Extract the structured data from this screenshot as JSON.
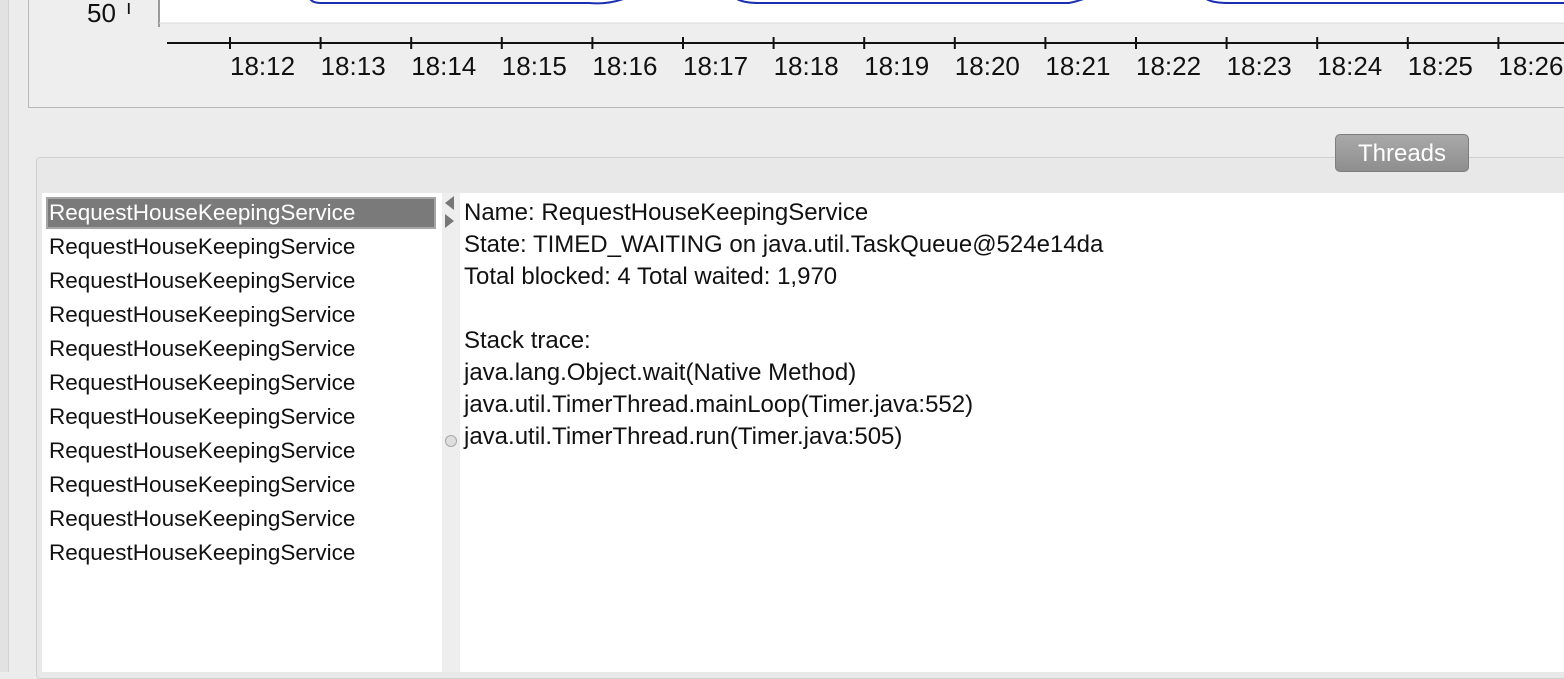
{
  "chart": {
    "y_tick_label": "50",
    "time_labels": [
      "18:12",
      "18:13",
      "18:14",
      "18:15",
      "18:16",
      "18:17",
      "18:18",
      "18:19",
      "18:20",
      "18:21",
      "18:22",
      "18:23",
      "18:24",
      "18:25",
      "18:26"
    ],
    "line_color": "#1a2fb0"
  },
  "tabs": {
    "threads_label": "Threads"
  },
  "thread_list": {
    "items": [
      "RequestHouseKeepingService",
      "RequestHouseKeepingService",
      "RequestHouseKeepingService",
      "RequestHouseKeepingService",
      "RequestHouseKeepingService",
      "RequestHouseKeepingService",
      "RequestHouseKeepingService",
      "RequestHouseKeepingService",
      "RequestHouseKeepingService",
      "RequestHouseKeepingService",
      "RequestHouseKeepingService"
    ],
    "selected_index": 0,
    "selected_color": "#7a7a7a"
  },
  "details": {
    "name_line": "Name: RequestHouseKeepingService",
    "state_line": "State: TIMED_WAITING on java.util.TaskQueue@524e14da",
    "totals_line": "Total blocked: 4  Total waited: 1,970",
    "stack_trace_header": "Stack trace:",
    "stack_frames": [
      "java.lang.Object.wait(Native Method)",
      "java.util.TimerThread.mainLoop(Timer.java:552)",
      "java.util.TimerThread.run(Timer.java:505)"
    ]
  }
}
